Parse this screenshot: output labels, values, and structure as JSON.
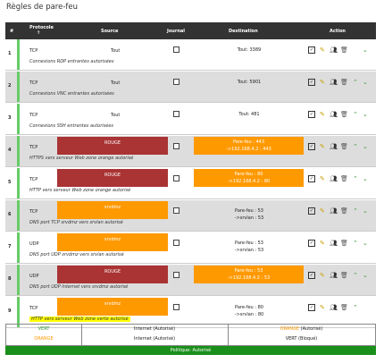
{
  "page": {
    "title": "Règles de pare-feu"
  },
  "table": {
    "headers": {
      "num": "#",
      "proto": "Protocole",
      "proto_arrow": "↑",
      "source": "Source",
      "journal": "Journal",
      "destination": "Destination",
      "action": "Action"
    },
    "rows": [
      {
        "num": "1",
        "proto": "TCP",
        "source": "Tout",
        "src_color": "",
        "dest_l1": "Tout: 3389",
        "dest_l2": "",
        "dest_color": "",
        "desc": "Connexions RDP entrantes autorisées",
        "up": false,
        "down": true
      },
      {
        "num": "2",
        "proto": "TCP",
        "source": "Tout",
        "src_color": "",
        "dest_l1": "Tout: 5901",
        "dest_l2": "",
        "dest_color": "",
        "desc": "Connexions VNC entrantes autorisées",
        "up": true,
        "down": true
      },
      {
        "num": "3",
        "proto": "TCP",
        "source": "Tout",
        "src_color": "",
        "dest_l1": "Tout: 481",
        "dest_l2": "",
        "dest_color": "",
        "desc": "Connexions SSH entrantes autorisées",
        "up": true,
        "down": true
      },
      {
        "num": "4",
        "proto": "TCP",
        "source": "ROUGE",
        "src_color": "red",
        "dest_l1": "Pare-feu : 443",
        "dest_l2": "->192.168.4.2 : 443",
        "dest_color": "orange",
        "desc": "HTTPS vers serveur Web zone orange autorisé",
        "up": true,
        "down": true
      },
      {
        "num": "5",
        "proto": "TCP",
        "source": "ROUGE",
        "src_color": "red",
        "dest_l1": "Pare-feu : 80",
        "dest_l2": "->192.168.4.2 : 80",
        "dest_color": "orange",
        "desc": "HTTP vers serveur Web zone orange autorisé",
        "up": true,
        "down": true
      },
      {
        "num": "6",
        "proto": "TCP",
        "source": "srvdmz",
        "src_color": "orange",
        "dest_l1": "Pare-feu : 53",
        "dest_l2": "->srvlan : 53",
        "dest_color": "",
        "desc": "DNS port TCP srvdmz vers srvlan autorisé",
        "up": true,
        "down": true
      },
      {
        "num": "7",
        "proto": "UDP",
        "source": "srvdmz",
        "src_color": "orange",
        "dest_l1": "Pare-feu : 53",
        "dest_l2": "->srvlan : 53",
        "dest_color": "",
        "desc": "DNS port UDP srvdmz vers srvlan autorisé",
        "up": true,
        "down": true
      },
      {
        "num": "8",
        "proto": "UDP",
        "source": "ROUGE",
        "src_color": "red",
        "dest_l1": "Pare-feu : 53",
        "dest_l2": "->192.168.4.2 : 53",
        "dest_color": "orange",
        "desc": "DNS port UDP Internet vers srvdmz autorisé",
        "up": true,
        "down": true
      },
      {
        "num": "9",
        "proto": "TCP",
        "source": "srvdmz",
        "src_color": "orange",
        "dest_l1": "Pare-feu : 80",
        "dest_l2": "->srvlan : 80",
        "dest_color": "",
        "desc": "HTTP vers serveur Web zone verte autorisé",
        "up": true,
        "down": false,
        "highlight": true
      }
    ]
  },
  "legend": {
    "c1_l1": "VERT",
    "c1_l2": "ORANGE",
    "c2_l1": "Internet (Autorisé)",
    "c2_l2": "Internet (Autorisé)",
    "c3_l1a": "ORANGE",
    "c3_l1b": " (Autorisé)",
    "c3_l2a": "VERT",
    "c3_l2b": " (Bloqué)"
  },
  "policy": "Politique: Autorisé",
  "icons": {
    "checkbox": "checkbox-icon",
    "pencil": "pencil-icon",
    "users": "users-icon",
    "trash": "trash-icon",
    "up": "chevron-up-icon",
    "down": "chevron-down-icon"
  },
  "colors": {
    "red": "#a33333",
    "orange": "#ff9900",
    "green": "#66cc66",
    "policy": "#1a8f1a"
  }
}
